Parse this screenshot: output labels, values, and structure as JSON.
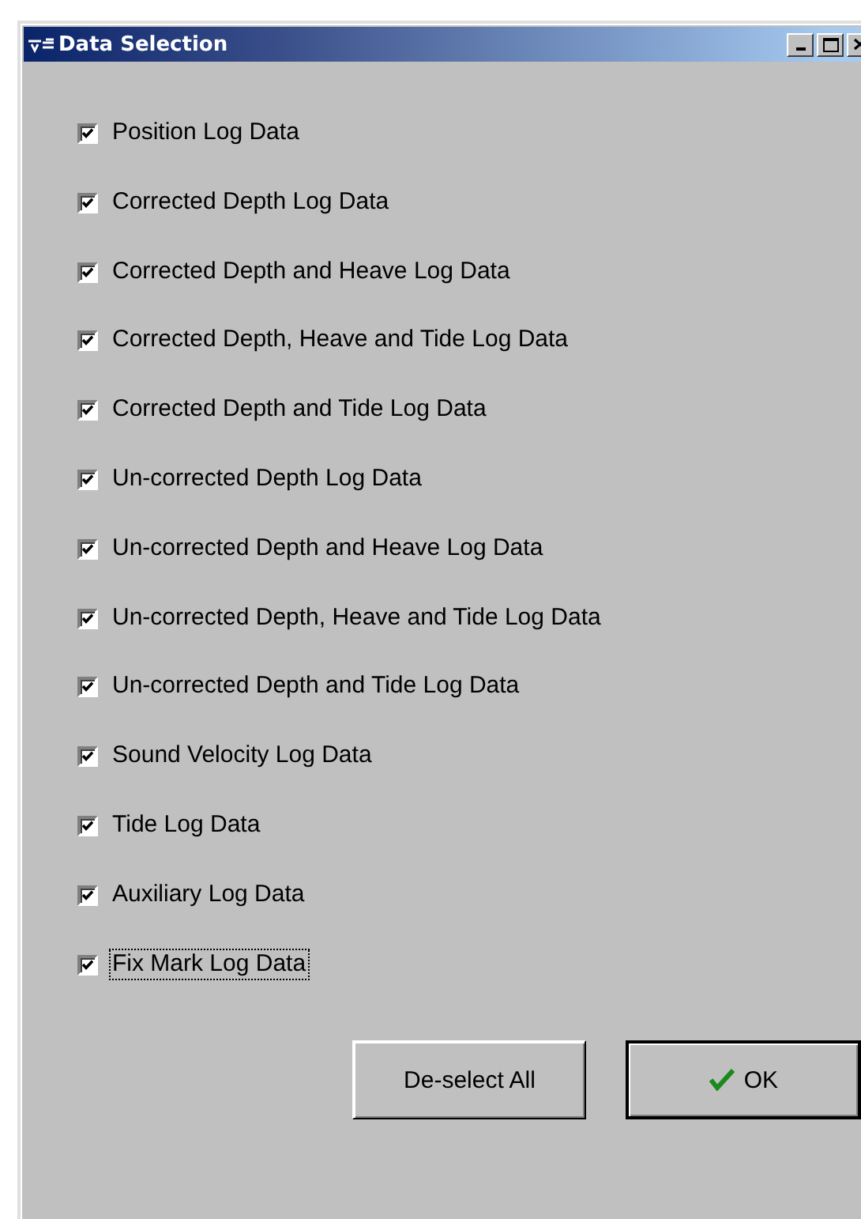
{
  "window": {
    "title": "Data Selection"
  },
  "options": [
    {
      "label": "Position Log Data",
      "checked": true,
      "focused": false
    },
    {
      "label": "Corrected Depth Log Data",
      "checked": true,
      "focused": false
    },
    {
      "label": "Corrected Depth and Heave Log Data",
      "checked": true,
      "focused": false
    },
    {
      "label": "Corrected Depth, Heave and Tide Log Data",
      "checked": true,
      "focused": false
    },
    {
      "label": "Corrected Depth and Tide Log Data",
      "checked": true,
      "focused": false
    },
    {
      "label": "Un-corrected Depth Log Data",
      "checked": true,
      "focused": false
    },
    {
      "label": "Un-corrected Depth and Heave Log Data",
      "checked": true,
      "focused": false
    },
    {
      "label": "Un-corrected Depth, Heave and Tide Log Data",
      "checked": true,
      "focused": false
    },
    {
      "label": "Un-corrected Depth and Tide Log Data",
      "checked": true,
      "focused": false
    },
    {
      "label": "Sound Velocity Log Data",
      "checked": true,
      "focused": false
    },
    {
      "label": "Tide Log Data",
      "checked": true,
      "focused": false
    },
    {
      "label": "Auxiliary Log Data",
      "checked": true,
      "focused": false
    },
    {
      "label": "Fix Mark Log Data",
      "checked": true,
      "focused": true
    }
  ],
  "buttons": [
    {
      "label": "De-select All",
      "kind": "plain",
      "default": false
    },
    {
      "label": "OK",
      "kind": "ok",
      "default": true
    }
  ]
}
